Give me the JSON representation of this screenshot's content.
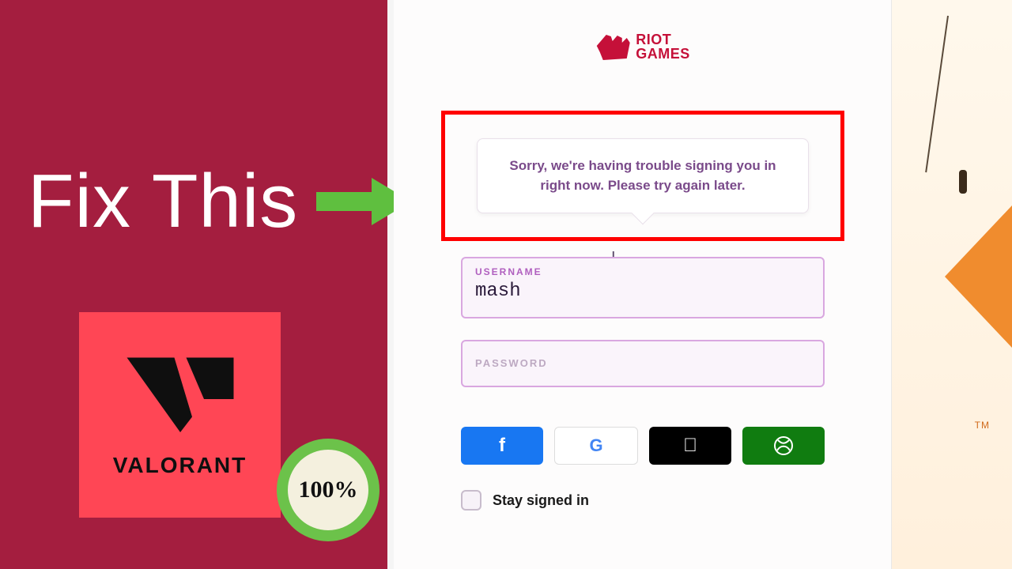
{
  "overlay": {
    "headline": "Fix This",
    "valorant_word": "VALORANT",
    "badge_percent": "100%"
  },
  "brand": {
    "line1": "RIOT",
    "line2": "GAMES"
  },
  "error": {
    "message": "Sorry, we're having trouble signing you in right now. Please try again later."
  },
  "form": {
    "username_label": "USERNAME",
    "username_value": "mash",
    "password_placeholder": "PASSWORD",
    "stay_signed_in_label": "Stay signed in",
    "stay_signed_in_checked": false
  },
  "social": {
    "facebook": "facebook",
    "google": "google",
    "apple": "apple",
    "xbox": "xbox"
  },
  "decor": {
    "tm": "TM"
  }
}
